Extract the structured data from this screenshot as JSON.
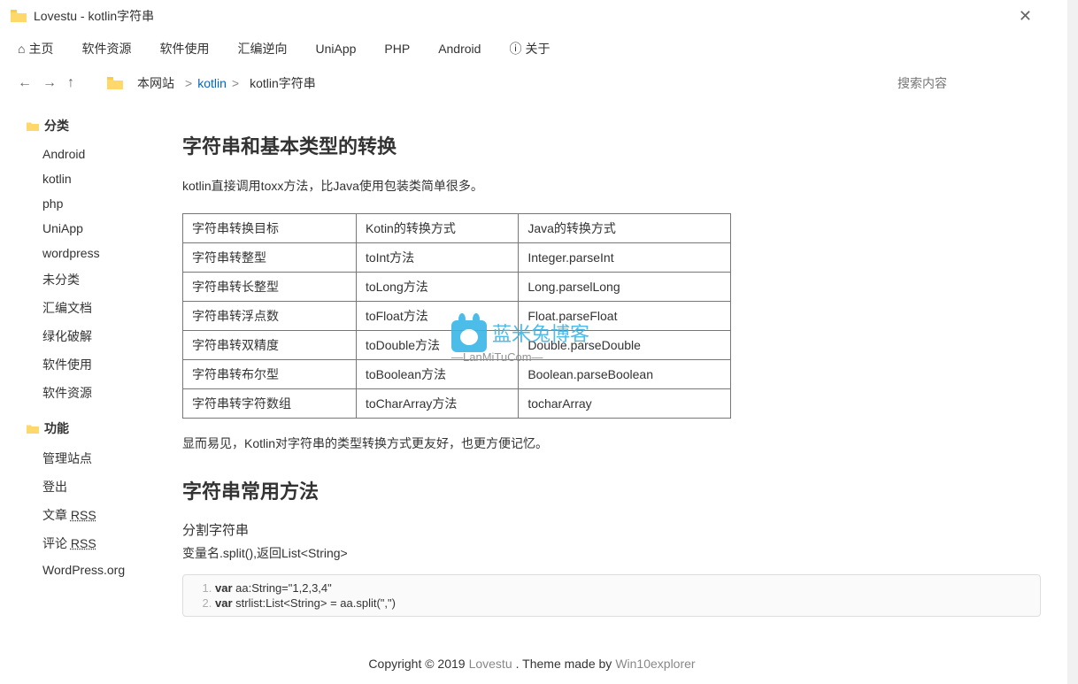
{
  "window": {
    "title": "Lovestu - kotlin字符串"
  },
  "menu": {
    "home": "主页",
    "softRes": "软件资源",
    "softUse": "软件使用",
    "reverse": "汇编逆向",
    "uniapp": "UniApp",
    "php": "PHP",
    "android": "Android",
    "about": "关于"
  },
  "breadcrumb": {
    "root": "本网站",
    "kotlin": "kotlin",
    "current": "kotlin字符串"
  },
  "search": {
    "placeholder": "搜索内容"
  },
  "sidebar": {
    "catTitle": "分类",
    "cats": [
      "Android",
      "kotlin",
      "php",
      "UniApp",
      "wordpress",
      "未分类",
      "汇编文档",
      "绿化破解",
      "软件使用",
      "软件资源"
    ],
    "funcTitle": "功能",
    "funcs": [
      "管理站点",
      "登出",
      "文章 RSS",
      "评论 RSS",
      "WordPress.org"
    ]
  },
  "article": {
    "h1": "字符串和基本类型的转换",
    "p1": "kotlin直接调用toxx方法，比Java使用包装类简单很多。",
    "table": {
      "head": [
        "字符串转换目标",
        "Kotin的转换方式",
        "Java的转换方式"
      ],
      "rows": [
        [
          "字符串转整型",
          "toInt方法",
          "Integer.parseInt"
        ],
        [
          "字符串转长整型",
          "toLong方法",
          "Long.parselLong"
        ],
        [
          "字符串转浮点数",
          "toFloat方法",
          "Float.parseFloat"
        ],
        [
          "字符串转双精度",
          "toDouble方法",
          "Double.parseDouble"
        ],
        [
          "字符串转布尔型",
          "toBoolean方法",
          "Boolean.parseBoolean"
        ],
        [
          "字符串转字符数组",
          "toCharArray方法",
          "tocharArray"
        ]
      ]
    },
    "p2": "显而易见，Kotlin对字符串的类型转换方式更友好，也更方便记忆。",
    "h2": "字符串常用方法",
    "subh": "分割字符串",
    "p3": "变量名.split(),返回List<String>",
    "code": {
      "l1a": "var",
      "l1b": " aa:String=",
      "l1c": "\"1,2,3,4\"",
      "l2a": "var",
      "l2b": " strlist:List<String> = aa.split(",
      "l2c": "\",\"",
      "l2d": ")"
    }
  },
  "watermark": {
    "main": "蓝米兔博客",
    "sub": "—LanMiTuCom—"
  },
  "footer": {
    "copy": "Copyright © 2019 ",
    "site": "Lovestu",
    "mid": " . Theme made by ",
    "theme": "Win10explorer"
  }
}
